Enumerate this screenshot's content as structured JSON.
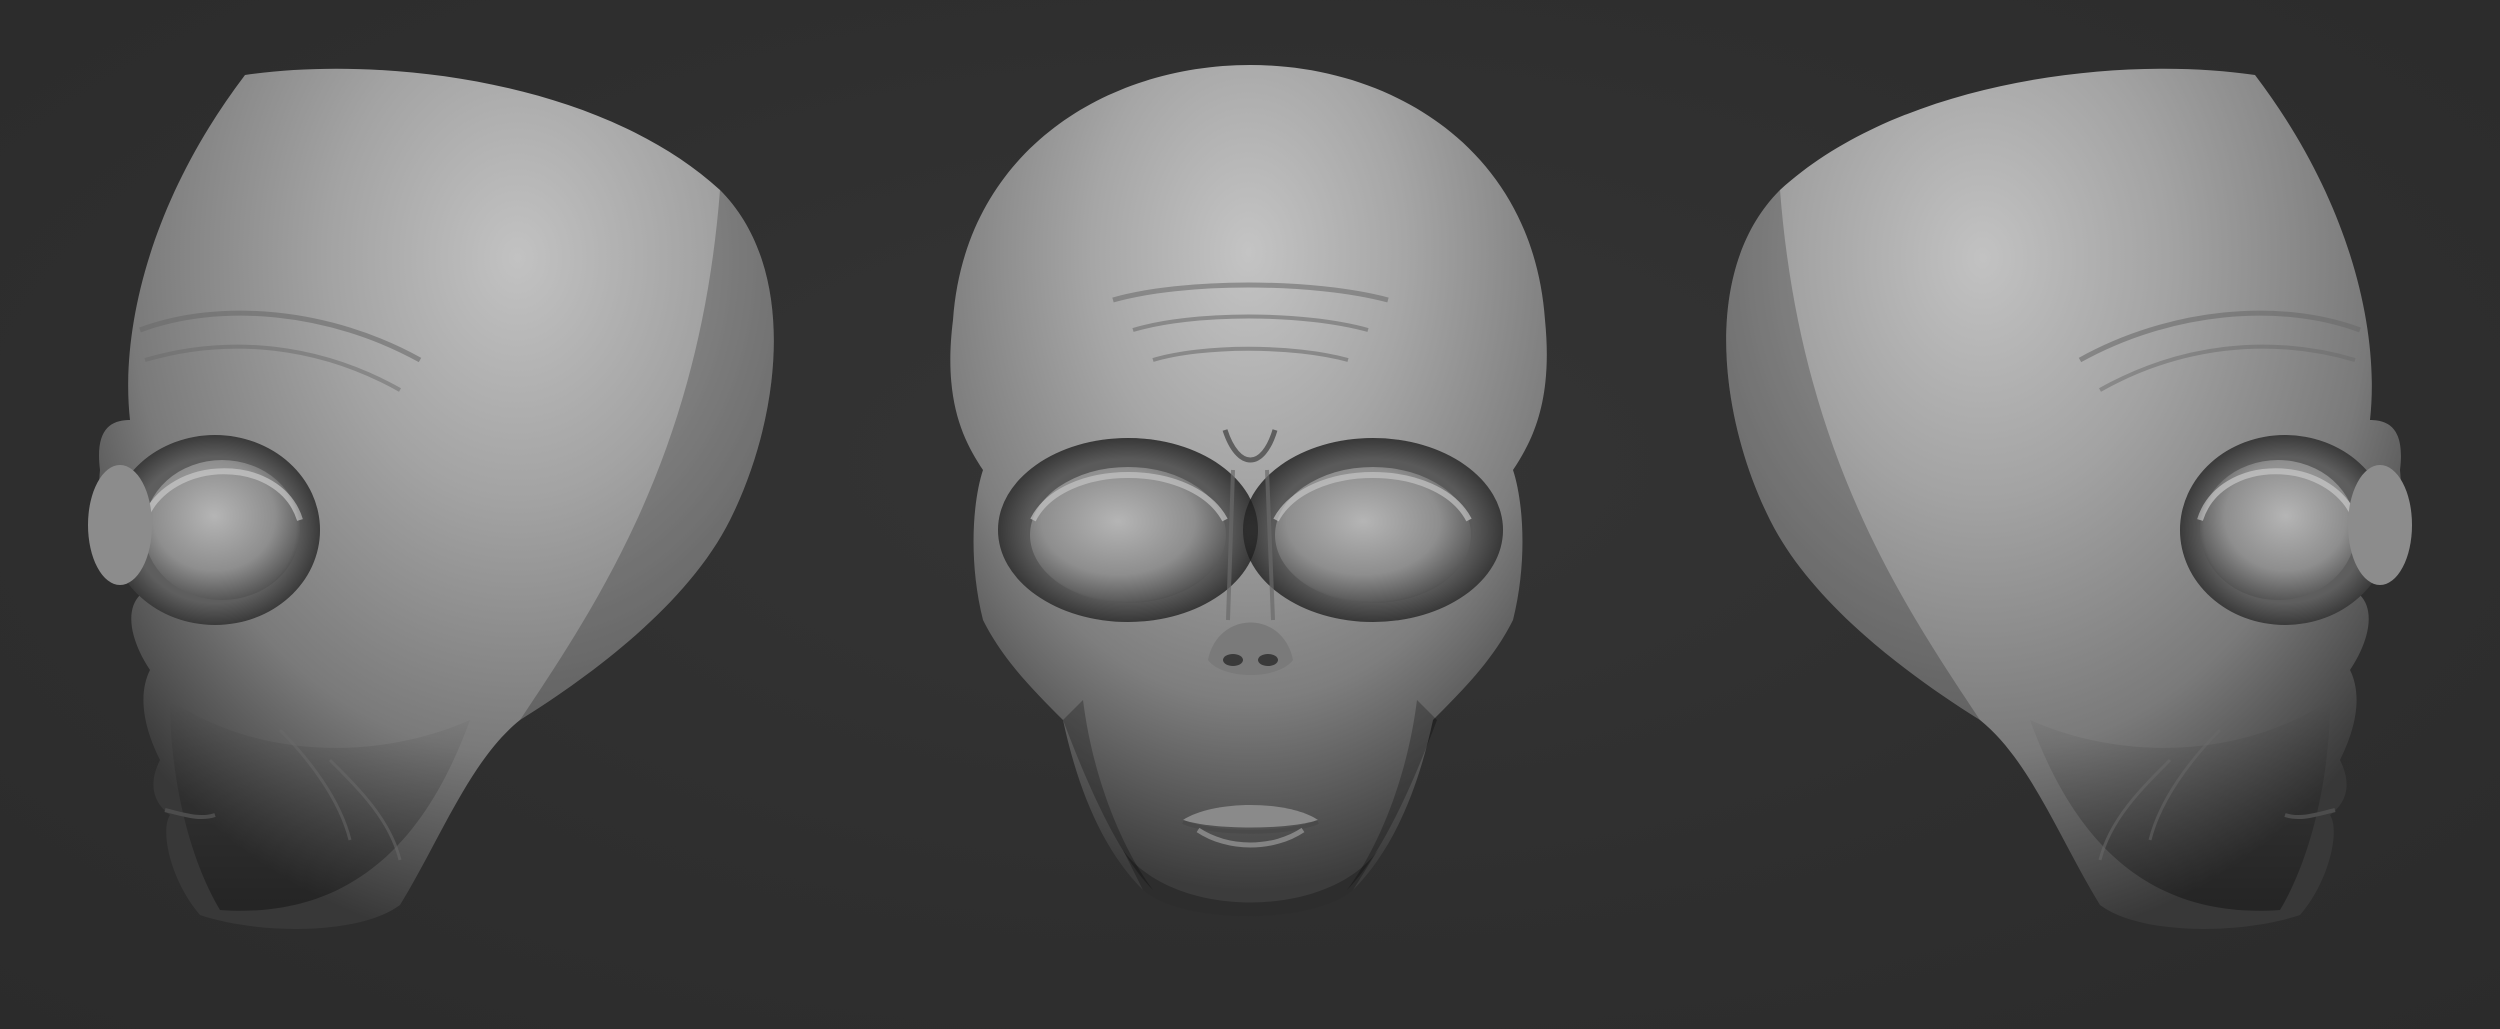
{
  "scene": {
    "background_color": "#2f2f2f",
    "material_color": "#9a9a9a",
    "views": [
      {
        "name": "left-profile",
        "orientation": "left"
      },
      {
        "name": "front",
        "orientation": "front"
      },
      {
        "name": "right-profile",
        "orientation": "right"
      }
    ]
  }
}
